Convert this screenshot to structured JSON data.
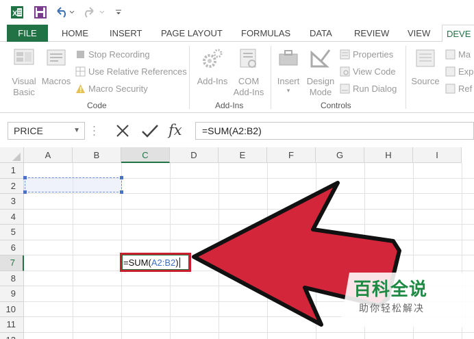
{
  "qat": {
    "icons": [
      "excel-logo-icon",
      "save-icon",
      "undo-icon",
      "redo-icon",
      "customize-icon"
    ]
  },
  "tabs": [
    {
      "label": "FILE"
    },
    {
      "label": "HOME"
    },
    {
      "label": "INSERT"
    },
    {
      "label": "PAGE LAYOUT"
    },
    {
      "label": "FORMULAS"
    },
    {
      "label": "DATA"
    },
    {
      "label": "REVIEW"
    },
    {
      "label": "VIEW"
    },
    {
      "label": "DEVE"
    }
  ],
  "ribbon": {
    "code": {
      "label": "Code",
      "visual_basic": "Visual\nBasic",
      "macros": "Macros",
      "stop_recording": "Stop Recording",
      "relative_refs": "Use Relative References",
      "macro_security": "Macro Security"
    },
    "addins": {
      "label": "Add-Ins",
      "addins": "Add-Ins",
      "com_addins": "COM\nAdd-Ins"
    },
    "controls": {
      "label": "Controls",
      "insert": "Insert",
      "design_mode": "Design\nMode",
      "properties": "Properties",
      "view_code": "View Code",
      "run_dialog": "Run Dialog"
    },
    "xml": {
      "source": "Source",
      "map": "Ma",
      "expand": "Exp",
      "refresh": "Ref"
    }
  },
  "formula_bar": {
    "name_box": "PRICE",
    "fx_label": "fx",
    "formula": "=SUM(A2:B2)"
  },
  "grid": {
    "columns": [
      "A",
      "B",
      "C",
      "D",
      "E",
      "F",
      "G",
      "H",
      "I"
    ],
    "rows": [
      "1",
      "2",
      "3",
      "4",
      "5",
      "6",
      "7",
      "8",
      "9",
      "10",
      "11",
      "12"
    ],
    "active_cell": {
      "prefix": "=SUM(",
      "ref": "A2:B2",
      "suffix": ")"
    }
  },
  "watermark": {
    "title": "百科全说",
    "subtitle": "助你轻松解决"
  },
  "colors": {
    "excel_green": "#217346",
    "arrow_red": "#d3263a",
    "highlight_red": "#c8202c",
    "reference_blue": "#3b6fc6"
  }
}
